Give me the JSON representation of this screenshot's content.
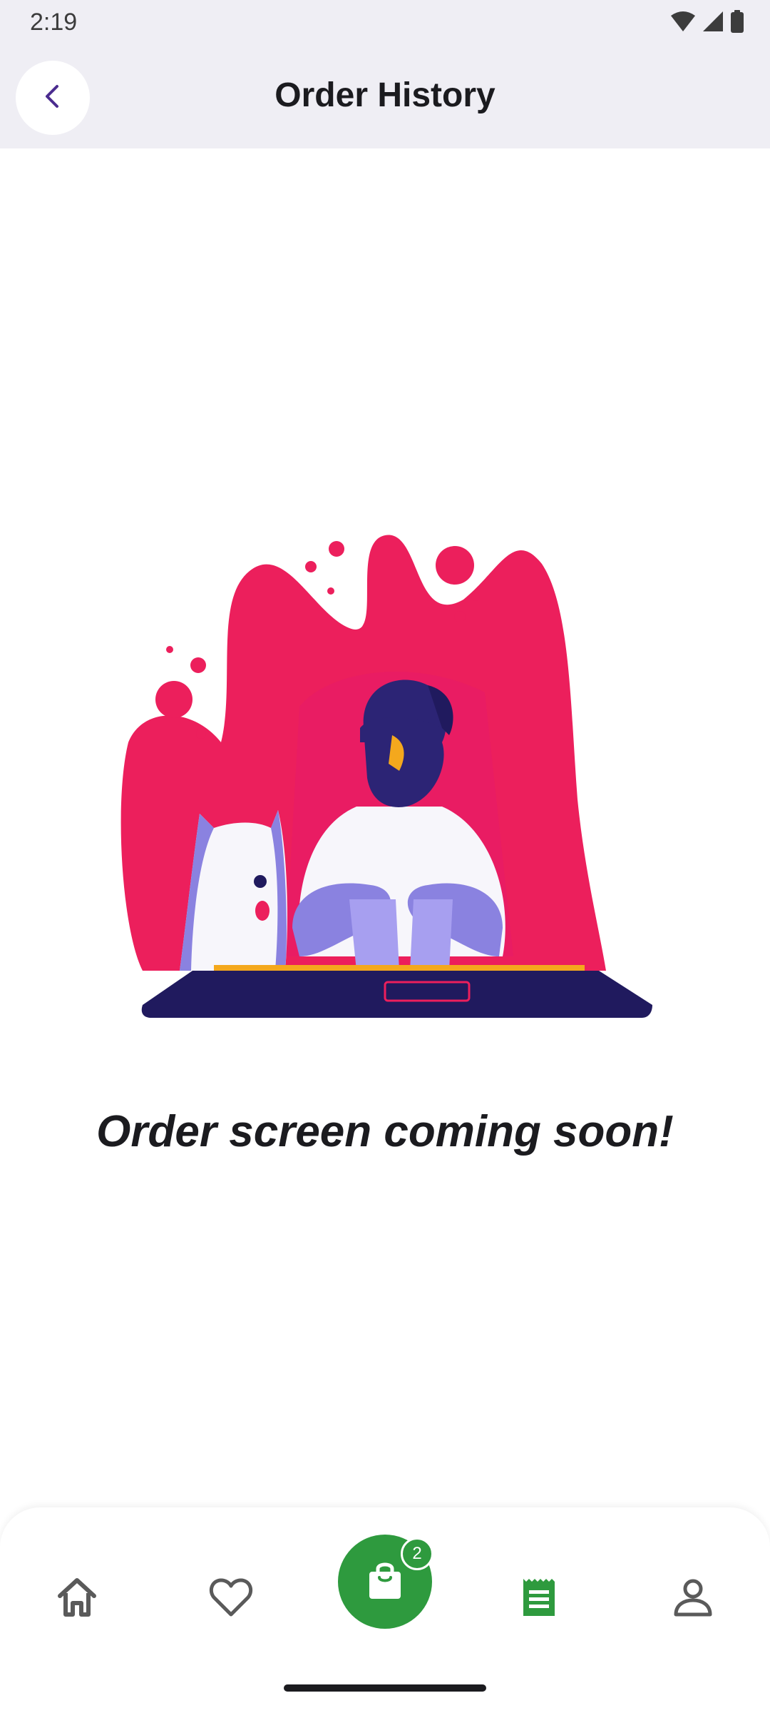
{
  "status_bar": {
    "time": "2:19",
    "icons": [
      "wifi-icon",
      "cellular-signal-icon",
      "battery-icon"
    ]
  },
  "header": {
    "title": "Order History",
    "back_icon": "chevron-left-icon"
  },
  "main": {
    "illustration": "person-with-dog-at-laptop-illustration",
    "message": "Order screen coming soon!"
  },
  "bottom_nav": {
    "items": [
      {
        "icon": "home-icon",
        "active": false
      },
      {
        "icon": "heart-icon",
        "active": false
      },
      {
        "icon": "shopping-bag-icon",
        "active": false,
        "badge": "2"
      },
      {
        "icon": "receipt-icon",
        "active": true
      },
      {
        "icon": "person-icon",
        "active": false
      }
    ]
  },
  "colors": {
    "accent": "#2e9a3e",
    "back_chevron": "#4b2c8f",
    "header_bg": "#efeef4",
    "illustration_pink": "#ec1f5c",
    "illustration_navy": "#201a5e",
    "illustration_lavender": "#8a82e0"
  }
}
